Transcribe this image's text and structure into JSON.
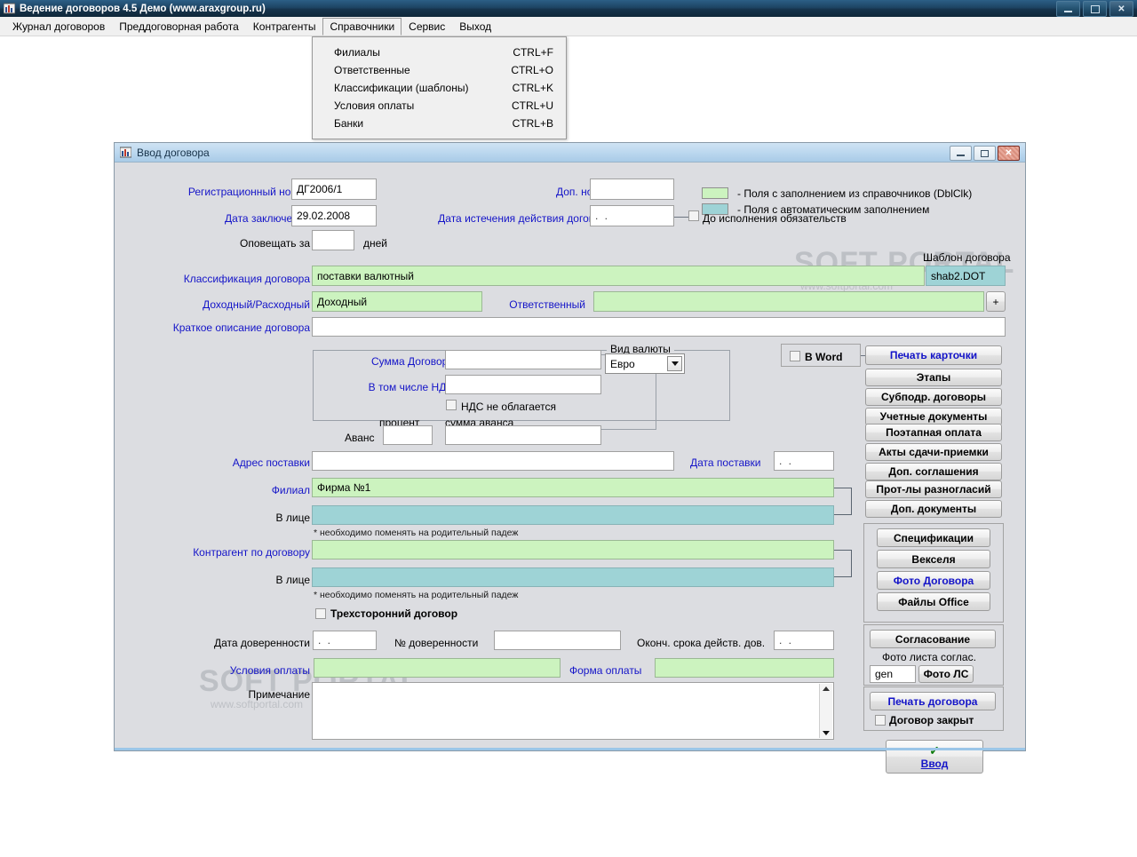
{
  "app": {
    "title": "Ведение договоров 4.5 Демо (www.araxgroup.ru)",
    "icon": "app-chart-icon",
    "window_buttons": {
      "minimize": "minimize-icon",
      "maximize": "maximize-icon",
      "close": "✕"
    }
  },
  "menubar": {
    "items": [
      {
        "label": "Журнал договоров",
        "active": false
      },
      {
        "label": "Преддоговорная работа",
        "active": false
      },
      {
        "label": "Контрагенты",
        "active": false
      },
      {
        "label": "Справочники",
        "active": true
      },
      {
        "label": "Сервис",
        "active": false
      },
      {
        "label": "Выход",
        "active": false
      }
    ]
  },
  "dropdown": {
    "open_for": "Справочники",
    "items": [
      {
        "label": "Филиалы",
        "accel": "CTRL+F"
      },
      {
        "label": "Ответственные",
        "accel": "CTRL+O"
      },
      {
        "label": "Классификации (шаблоны)",
        "accel": "CTRL+K"
      },
      {
        "label": "Условия оплаты",
        "accel": "CTRL+U"
      },
      {
        "label": "Банки",
        "accel": "CTRL+B"
      }
    ]
  },
  "form": {
    "title": "Ввод договора",
    "icon": "form-chart-icon",
    "window_buttons": {
      "minimize": "minimize-icon",
      "maximize": "maximize-icon",
      "close": "✕"
    },
    "legend": [
      {
        "swatch": "green",
        "text": "-  Поля с заполнением из справочников (DblClk)"
      },
      {
        "swatch": "teal",
        "text": "- Поля с автоматическим заполнением"
      }
    ],
    "fields": {
      "reg_number": {
        "label": "Регистрационный номер",
        "value": "ДГ2006/1"
      },
      "dop_number": {
        "label": "Доп. номер",
        "value": ""
      },
      "date_conclusion": {
        "label": "Дата заключения",
        "value": "29.02.2008"
      },
      "date_expiry": {
        "label": "Дата истечения действия договора",
        "value": " .  ."
      },
      "until_fulfillment": {
        "label": "До исполнения обязательств",
        "checked": false
      },
      "notify_days": {
        "label": "Оповещать за",
        "value": "",
        "suffix": "дней"
      },
      "classification": {
        "label": "Классификация договора",
        "value": "поставки валютный"
      },
      "template": {
        "label": "Шаблон договора",
        "value": "shab2.DOT"
      },
      "income_expense": {
        "label": "Доходный/Расходный",
        "value": "Доходный"
      },
      "responsible": {
        "label": "Ответственный",
        "value": "",
        "add_button": "+"
      },
      "short_desc": {
        "label": "Краткое описание договора",
        "value": ""
      },
      "sum_contract": {
        "label": "Сумма Договора",
        "value": ""
      },
      "vat_included": {
        "label": "В том числе НДС",
        "value": ""
      },
      "vat_exempt": {
        "label": "НДС не облагается",
        "checked": false
      },
      "advance": {
        "label": "Аванс",
        "percent_label": "процент",
        "percent_value": "",
        "sum_label": "сумма аванса",
        "sum_value": ""
      },
      "currency": {
        "group_label": "Вид валюты",
        "value": "Евро"
      },
      "delivery_address": {
        "label": "Адрес поставки",
        "value": ""
      },
      "delivery_date": {
        "label": "Дата поставки",
        "value": " .  ."
      },
      "branch": {
        "label": "Филиал",
        "value": "Фирма №1"
      },
      "branch_person": {
        "label": "В лице",
        "value": ""
      },
      "branch_hint": {
        "text": "* необходимо поменять на родительный падеж"
      },
      "counterparty": {
        "label": "Контрагент по договору",
        "value": ""
      },
      "counterparty_person": {
        "label": "В лице",
        "value": ""
      },
      "counterparty_hint": {
        "text": "* необходимо поменять на родительный падеж"
      },
      "tripartite": {
        "label": "Трехсторонний договор",
        "checked": false
      },
      "poa_date": {
        "label": "Дата доверенности",
        "value": " .  ."
      },
      "poa_number": {
        "label": "№ доверенности",
        "value": ""
      },
      "poa_end": {
        "label": "Оконч. срока действ. дов.",
        "value": " .  ."
      },
      "payment_terms": {
        "label": "Условия оплаты",
        "value": ""
      },
      "payment_form": {
        "label": "Форма оплаты",
        "value": ""
      },
      "remark": {
        "label": "Примечание",
        "value": ""
      }
    },
    "right_panel": {
      "in_word": {
        "label": "В Word",
        "checked": false
      },
      "buttons_top": [
        {
          "label": "Печать карточки",
          "style": "blue"
        },
        {
          "label": "Этапы",
          "style": "normal"
        },
        {
          "label": "Субподр. договоры",
          "style": "normal"
        },
        {
          "label": "Учетные документы",
          "style": "normal"
        },
        {
          "label": "Поэтапная оплата",
          "style": "normal"
        },
        {
          "label": "Акты сдачи-приемки",
          "style": "normal"
        },
        {
          "label": "Доп. соглашения",
          "style": "normal"
        },
        {
          "label": "Прот-лы разногласий",
          "style": "normal"
        },
        {
          "label": "Доп. документы",
          "style": "normal"
        }
      ],
      "buttons_group2": [
        {
          "label": "Спецификации",
          "style": "normal"
        },
        {
          "label": "Векселя",
          "style": "normal"
        },
        {
          "label": "Фото Договора",
          "style": "blue"
        },
        {
          "label": "Файлы Office",
          "style": "normal"
        }
      ],
      "approval": {
        "button": "Согласование",
        "photo_label": "Фото листа соглас.",
        "photo_value": "gen",
        "photo_button": "Фото ЛС"
      },
      "print_contract": {
        "label": "Печать договора",
        "style": "blue"
      },
      "contract_closed": {
        "label": "Договор закрыт",
        "checked": false
      },
      "submit": {
        "label": "Ввод",
        "icon": "check-icon"
      }
    }
  },
  "watermarks": [
    {
      "main": "SOFT PORTAL",
      "sub": "www.softportal.com"
    },
    {
      "main": "SOFT PORTAL",
      "sub": "www.softportal.com"
    }
  ],
  "colors": {
    "field_lookup_green": "#ccf3bf",
    "field_auto_teal": "#9ed3d6",
    "label_blue": "#1414c8",
    "form_bg": "#dcdde1",
    "titlebar_blue": "#1d4463"
  }
}
